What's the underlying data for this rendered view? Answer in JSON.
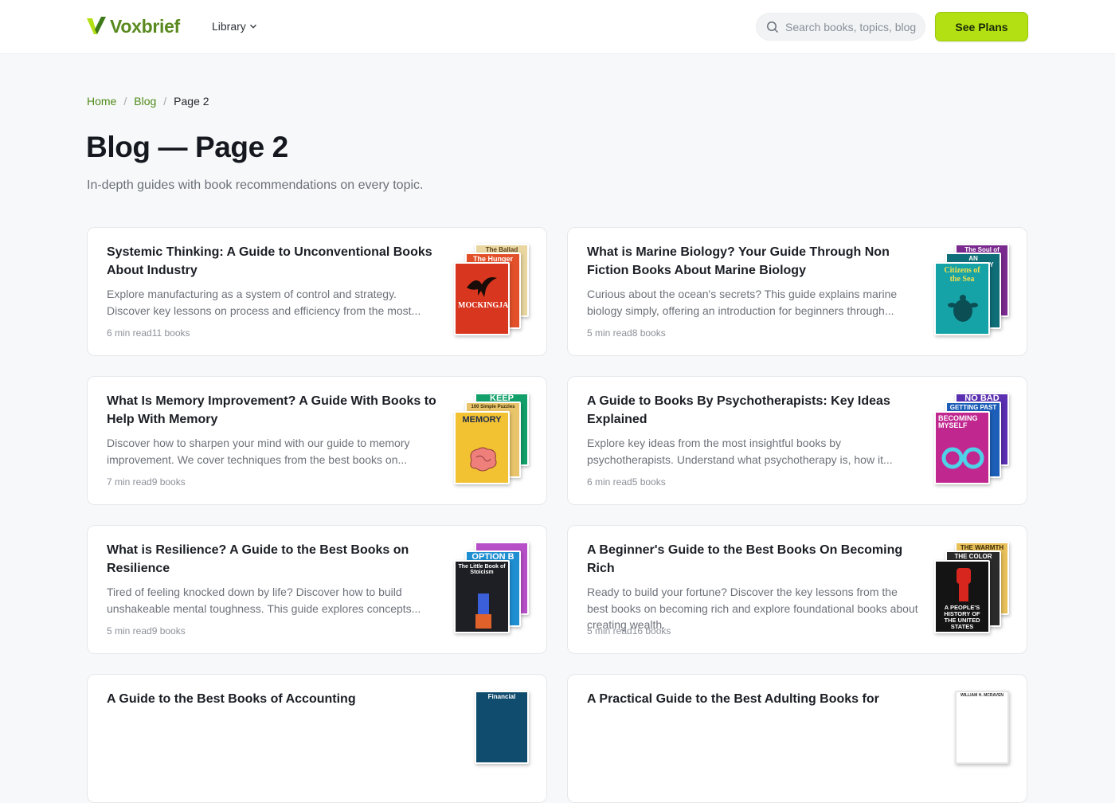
{
  "header": {
    "logo_text": "Voxbrief",
    "nav_library": "Library",
    "search_placeholder": "Search books, topics, blog",
    "plans_label": "See Plans",
    "colors": {
      "accent": "#b3e012",
      "brand_green": "#4f8a18"
    }
  },
  "breadcrumb": {
    "home": "Home",
    "sep1": "/",
    "blog": "Blog",
    "sep2": "/",
    "current": "Page 2"
  },
  "page": {
    "title": "Blog — Page 2",
    "subtitle": "In-depth guides with book recommendations on every topic."
  },
  "cards": [
    {
      "title": "Systemic Thinking: A Guide to Unconventional Books About Industry",
      "desc": "Explore manufacturing as a system of control and strategy. Discover key lessons on process and efficiency from the most...",
      "meta": "6 min read11 books",
      "covers": [
        {
          "text": "The Ballad",
          "bg": "#e9d6a0",
          "fg": "#5a3d1a"
        },
        {
          "text": "The Hunger",
          "bg": "#e3512a",
          "fg": "#ffffff"
        },
        {
          "text": "MOCKINGJAY",
          "bg": "#d9361f",
          "fg": "#ffffff"
        }
      ]
    },
    {
      "title": "What is Marine Biology? Your Guide Through Non Fiction Books About Marine Biology",
      "desc": "Curious about the ocean's secrets? This guide explains marine biology simply, offering an introduction for beginners through...",
      "meta": "5 min read8 books",
      "covers": [
        {
          "text": "The Soul of",
          "bg": "#7a2a8f",
          "fg": "#ffffff"
        },
        {
          "text": "AN ANTHOLOGY",
          "bg": "#0f6e78",
          "fg": "#ffffff"
        },
        {
          "text": "Citizens of the Sea",
          "bg": "#16a3a8",
          "fg": "#f4e04a"
        }
      ]
    },
    {
      "title": "What Is Memory Improvement? A Guide With Books to Help With Memory",
      "desc": "Discover how to sharpen your mind with our guide to memory improvement. We cover techniques from the best books on...",
      "meta": "7 min read9 books",
      "covers": [
        {
          "text": "KEEP",
          "bg": "#12a06a",
          "fg": "#ffffff"
        },
        {
          "text": "100 Simple Puzzles",
          "bg": "#e9c46a",
          "fg": "#3b2d0a"
        },
        {
          "text": "MEMORY",
          "bg": "#f2c232",
          "fg": "#1f2d4a"
        }
      ]
    },
    {
      "title": "A Guide to Books By Psychotherapists: Key Ideas Explained",
      "desc": "Explore key ideas from the most insightful books by psychotherapists. Understand what psychotherapy is, how it...",
      "meta": "6 min read5 books",
      "covers": [
        {
          "text": "NO BAD",
          "bg": "#5a2fb0",
          "fg": "#ffffff"
        },
        {
          "text": "GETTING PAST",
          "bg": "#1d5fb8",
          "fg": "#ffffff"
        },
        {
          "text": "BECOMING MYSELF",
          "bg": "#c02890",
          "fg": "#ffffff"
        }
      ]
    },
    {
      "title": "What is Resilience? A Guide to the Best Books on Resilience",
      "desc": "Tired of feeling knocked down by life? Discover how to build unshakeable mental toughness. This guide explores concepts...",
      "meta": "5 min read9 books",
      "covers": [
        {
          "text": "",
          "bg": "#b64fc8",
          "fg": "#ffffff"
        },
        {
          "text": "OPTION B",
          "bg": "#1f8fd1",
          "fg": "#ffffff"
        },
        {
          "text": "The Little Book of Stoicism",
          "bg": "#1d1f24",
          "fg": "#ffffff"
        }
      ]
    },
    {
      "title": "A Beginner's Guide to the Best Books On Becoming Rich",
      "desc": "Ready to build your fortune? Discover the key lessons from the best books on becoming rich and explore foundational books about creating wealth.",
      "meta": "5 min read16 books",
      "covers": [
        {
          "text": "THE WARMTH",
          "bg": "#e8c15a",
          "fg": "#3a2a08"
        },
        {
          "text": "THE COLOR",
          "bg": "#2b2b2b",
          "fg": "#ffffff"
        },
        {
          "text": "A PEOPLE'S HISTORY OF THE UNITED STATES",
          "bg": "#141414",
          "fg": "#ffffff"
        }
      ]
    },
    {
      "title": "A Guide to the Best Books of Accounting",
      "desc": "",
      "meta": "",
      "covers": [
        {
          "text": "Financial",
          "bg": "#0f4c6e",
          "fg": "#ffffff"
        }
      ]
    },
    {
      "title": "A Practical Guide to the Best Adulting Books for",
      "desc": "",
      "meta": "",
      "covers": [
        {
          "text": "WILLIAM H. MCRAVEN",
          "bg": "#ffffff",
          "fg": "#2a2a2a"
        }
      ]
    }
  ]
}
